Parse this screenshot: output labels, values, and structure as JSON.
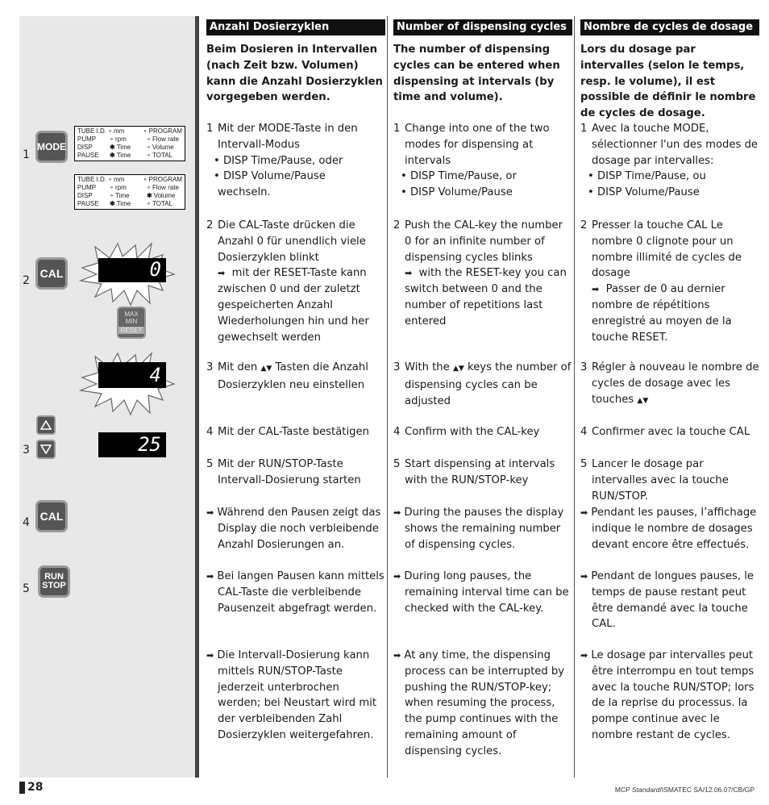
{
  "page": {
    "number": "28",
    "reference_prefix": "MCP ",
    "reference_italic": "Standard",
    "reference_suffix": "/ISMATEC SA/12.06.07/CB/GP"
  },
  "sidebar": {
    "steps": [
      "1",
      "2",
      "3",
      "4",
      "5"
    ],
    "keys": {
      "mode": "MODE",
      "cal": "CAL",
      "run": "RUN",
      "stop": "STOP",
      "max": "MAX",
      "min": "MIN",
      "reset": "RESET"
    },
    "panel": {
      "labels": [
        "TUBE I.D.",
        "PUMP",
        "DISP",
        "PAUSE"
      ],
      "mid": [
        "mm",
        "rpm",
        "Time",
        "Time"
      ],
      "right": [
        "PROGRAM",
        "Flow rate",
        "Volume",
        "TOTAL"
      ],
      "panel1_active_mid": [
        false,
        false,
        true,
        true
      ],
      "panel1_active_right": [
        false,
        false,
        false,
        false
      ],
      "panel2_active_mid": [
        false,
        false,
        false,
        true
      ],
      "panel2_active_right": [
        false,
        false,
        true,
        false
      ]
    },
    "displays": {
      "blink_zero": "0",
      "blink_four": "4",
      "value": "25"
    }
  },
  "columns": [
    {
      "heading": "Anzahl Dosierzyklen",
      "intro": "Beim Dosieren in Intervallen (nach Zeit bzw. Volumen) kann die Anzahl Dosierzyklen vorgegeben werden.",
      "s1_num": "1",
      "s1": "Mit der MODE-Taste in den Intervall-Modus",
      "s1_b1": "DISP Time/Pause, oder",
      "s1_b2": "DISP Volume/Pause",
      "s1_tail": "wechseln.",
      "s2_num": "2",
      "s2": "Die CAL-Taste drücken die Anzahl 0 für unendlich viele Dosierzyklen blinkt",
      "s2_note": "mit der RESET-Taste kann zwischen 0 und der zuletzt gespeicherten Anzahl Wiederholungen hin und her gewechselt werden",
      "s3_num": "3",
      "s3_pre": "Mit den",
      "s3_post": "Tasten die Anzahl Dosierzyklen neu einstellen",
      "s4_num": "4",
      "s4": "Mit der CAL-Taste bestätigen",
      "s5_num": "5",
      "s5": "Mit der RUN/STOP-Taste Intervall-Dosierung starten",
      "n1": "Während den Pausen zeigt das Display die noch verbleibende Anzahl Dosierungen an.",
      "n2": "Bei langen Pausen kann mittels CAL-Taste die verbleibende Pausenzeit abgefragt werden.",
      "n3": "Die Intervall-Dosierung kann mittels RUN/STOP-Taste jederzeit unterbrochen werden; bei Neustart wird mit der verbleibenden Zahl Dosierzyklen weitergefahren."
    },
    {
      "heading": "Number of dispensing cycles",
      "intro": "The number of dispensing cycles can be entered when dispensing at intervals (by time and volume).",
      "s1_num": "1",
      "s1": "Change into one of the two modes for dispensing at intervals",
      "s1_b1": "DISP Time/Pause, or",
      "s1_b2": "DISP Volume/Pause",
      "s1_tail": "",
      "s2_num": "2",
      "s2": "Push the CAL-key the number 0 for an infinite number of dispensing cycles blinks",
      "s2_note": "with the RESET-key you can switch between 0 and the number of repetitions last entered",
      "s3_num": "3",
      "s3_pre": "With the",
      "s3_post": "keys the number of dispensing cycles can be adjusted",
      "s4_num": "4",
      "s4": "Confirm with the CAL-key",
      "s5_num": "5",
      "s5": "Start dispensing at intervals with the RUN/STOP-key",
      "n1": "During the pauses the display shows the remaining number of dispensing cycles.",
      "n2": "During long pauses, the remaining interval time can be checked with the CAL-key.",
      "n3": "At any time, the dispensing process can be interrupted by pushing the RUN/STOP-key; when resuming the process, the pump continues with the remaining amount of dispensing cycles."
    },
    {
      "heading": "Nombre de cycles de dosage",
      "intro": "Lors du dosage par intervalles (selon le temps, resp. le volume), il est possible de définir le nombre de cycles de dosage.",
      "s1_num": "1",
      "s1": "Avec la touche MODE, sélectionner l'un des modes de dosage par intervalles:",
      "s1_b1": "DISP Time/Pause, ou",
      "s1_b2": "DISP Volume/Pause",
      "s1_tail": "",
      "s2_num": "2",
      "s2": "Presser la touche CAL Le nombre 0 clignote pour un nombre illimité de cycles de dosage",
      "s2_note": "Passer de 0 au dernier nombre de répétitions enregistré au moyen de la touche RESET.",
      "s3_num": "3",
      "s3_pre": "Régler à nouveau le nombre de cycles de dosage avec les touches",
      "s3_post": "",
      "s4_num": "4",
      "s4": "Confirmer avec la touche CAL",
      "s5_num": "5",
      "s5": "Lancer le dosage par intervalles avec la touche RUN/STOP.",
      "n1": "Pendant les pauses, l’affichage indique le nombre de dosages devant encore être effectués.",
      "n2": "Pendant de longues pauses, le temps de pause restant peut être demandé avec la touche CAL.",
      "n3": "Le dosage par intervalles peut être interrompu en tout temps avec la touche RUN/STOP; lors de la reprise du processus. la pompe continue avec le nombre restant de cycles."
    }
  ]
}
